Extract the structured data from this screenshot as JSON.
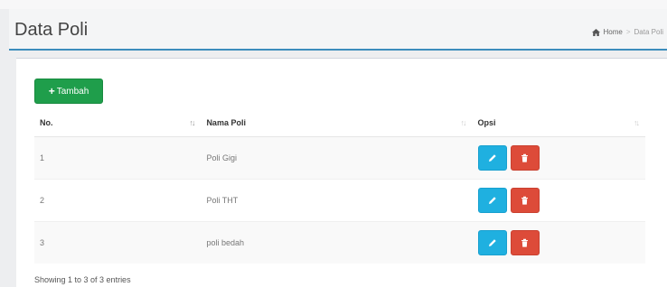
{
  "header": {
    "title": "Data Poli",
    "breadcrumb": {
      "home_icon": "home-icon",
      "home_label": "Home",
      "separator": ">",
      "current": "Data Poli"
    }
  },
  "toolbar": {
    "add_icon": "plus-icon",
    "add_label": "Tambah",
    "add_color": "#1f9e4b"
  },
  "table": {
    "columns": [
      "No.",
      "Nama Poli",
      "Opsi"
    ],
    "rows": [
      {
        "no": "1",
        "nama": "Poli Gigi"
      },
      {
        "no": "2",
        "nama": "Poli THT"
      },
      {
        "no": "3",
        "nama": "poli bedah"
      }
    ],
    "action_icons": {
      "edit": "pencil-icon",
      "delete": "trash-icon"
    },
    "action_colors": {
      "edit": "#1fb0e0",
      "delete": "#dd4b39"
    }
  },
  "footer": {
    "info": "Showing 1 to 3 of 3 entries"
  },
  "colors": {
    "accent": "#3c8dbc"
  }
}
